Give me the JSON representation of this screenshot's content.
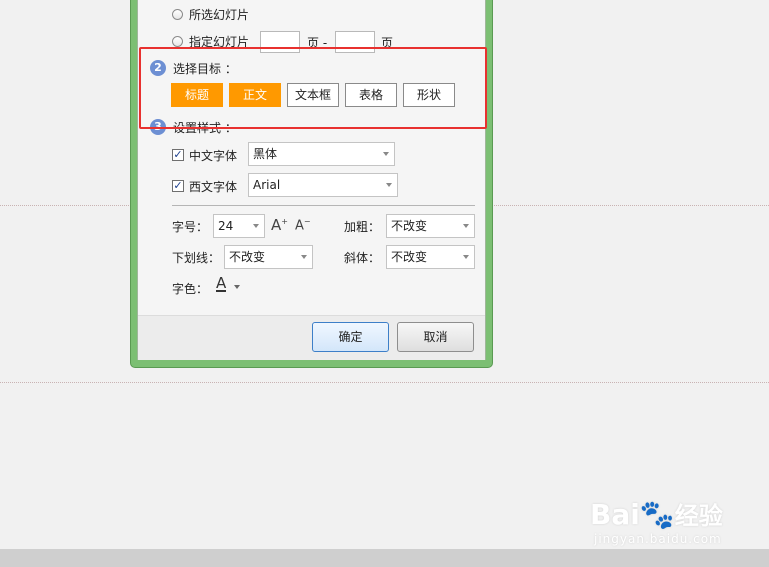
{
  "scope": {
    "selected_slides_label": "所选幻灯片",
    "specified_slides_label": "指定幻灯片",
    "page_label_1": "页 -",
    "page_label_2": "页"
  },
  "target": {
    "step_number": "2",
    "title": "选择目标 ：",
    "options": [
      {
        "label": "标题",
        "active": true
      },
      {
        "label": "正文",
        "active": true
      },
      {
        "label": "文本框",
        "active": false
      },
      {
        "label": "表格",
        "active": false
      },
      {
        "label": "形状",
        "active": false
      }
    ]
  },
  "style": {
    "step_number": "3",
    "title": "设置样式 ：",
    "chinese_font": {
      "label": "中文字体",
      "checked": true,
      "value": "黑体"
    },
    "western_font": {
      "label": "西文字体",
      "checked": true,
      "value": "Arial"
    },
    "size_label": "字号：",
    "size_value": "24",
    "grow_glyph": "A",
    "shrink_glyph": "A",
    "bold_label": "加粗：",
    "bold_value": "不改变",
    "underline_label": "下划线：",
    "underline_value": "不改变",
    "italic_label": "斜体：",
    "italic_value": "不改变",
    "color_label": "字色：",
    "color_glyph": "A"
  },
  "footer": {
    "ok_label": "确定",
    "cancel_label": "取消"
  },
  "watermark": {
    "brand": "Bai",
    "brand_suffix": "经验",
    "url": "jingyan.baidu.com"
  },
  "colors": {
    "accent_active": "#ff9900",
    "highlight_box": "#e8312f",
    "frame_green": "#7cbf73",
    "badge_blue": "#6d8fd3"
  }
}
